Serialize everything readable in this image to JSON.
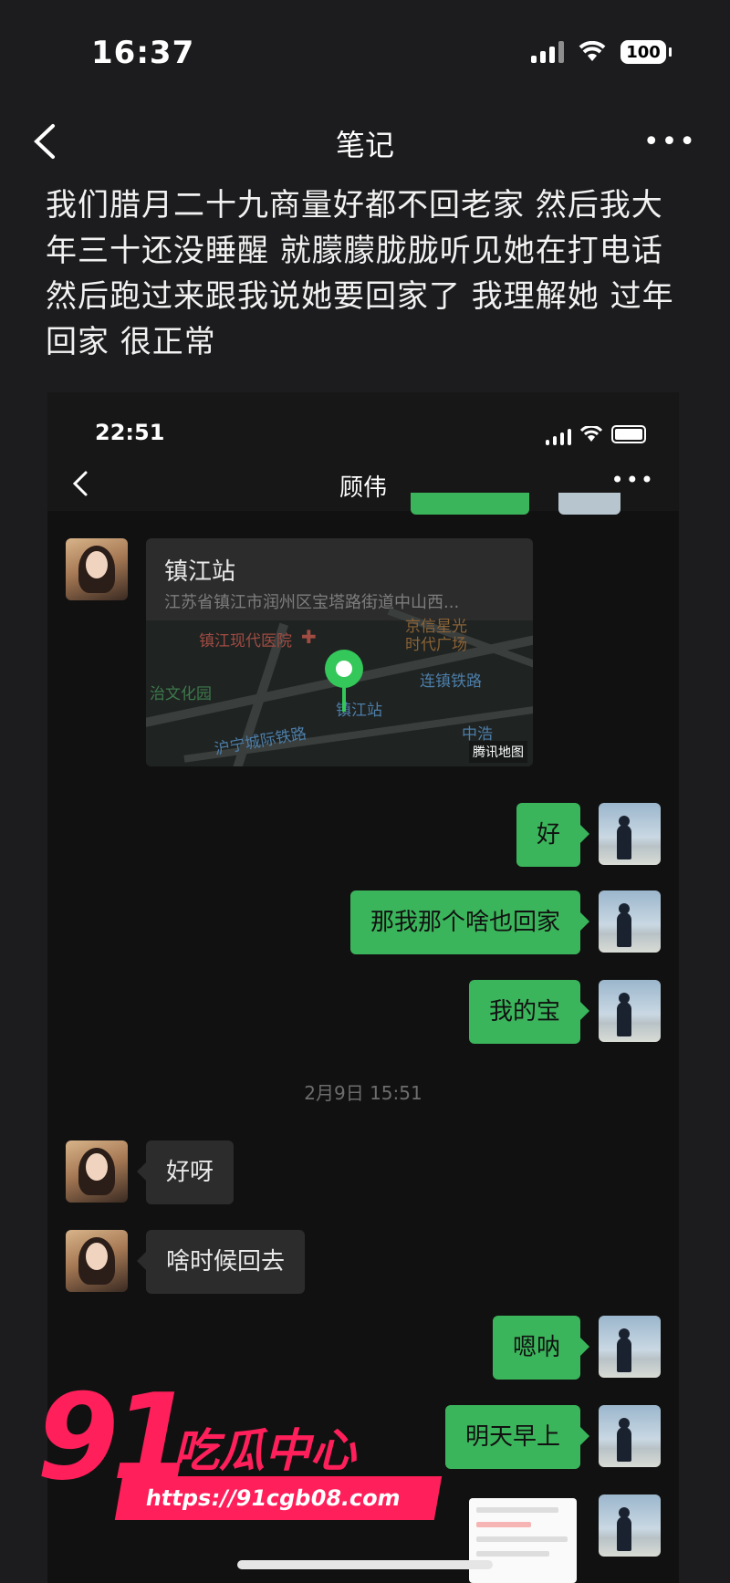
{
  "status_bar": {
    "time": "16:37",
    "battery": "100"
  },
  "nav": {
    "title": "笔记",
    "more": "•••"
  },
  "note": {
    "text": "我们腊月二十九商量好都不回老家 然后我大年三十还没睡醒 就朦朦胧胧听见她在打电话 然后跑过来跟我说她要回家了 我理解她 过年回家 很正常"
  },
  "screenshot": {
    "status_time": "22:51",
    "contact_name": "顾伟",
    "more": "•••",
    "location": {
      "name": "镇江站",
      "address": "江苏省镇江市润州区宝塔路街道中山西...",
      "map_labels": {
        "hospital": "镇江现代医院",
        "plaza_line1": "京信星光",
        "plaza_line2": "时代广场",
        "railway": "连镇铁路",
        "park": "治文化园",
        "intercity": "沪宁城际铁路",
        "station": "镇江站",
        "zhongjian": "中浩",
        "logo": "腾讯地图"
      }
    },
    "messages": [
      {
        "side": "right",
        "text": "好"
      },
      {
        "side": "right",
        "text": "那我那个啥也回家"
      },
      {
        "side": "right",
        "text": "我的宝"
      },
      {
        "side": "divider",
        "text": "2月9日 15:51"
      },
      {
        "side": "left",
        "text": "好呀"
      },
      {
        "side": "left",
        "text": "啥时候回去"
      },
      {
        "side": "right",
        "text": "嗯呐"
      },
      {
        "side": "right",
        "text": "明天早上"
      }
    ]
  },
  "watermark": {
    "number": "91",
    "brand": "吃瓜中心",
    "url": "https://91cgb08.com"
  },
  "colors": {
    "background": "#1c1c1e",
    "wechat_green": "#3bb55b",
    "watermark_pink": "#ff1f5a"
  }
}
